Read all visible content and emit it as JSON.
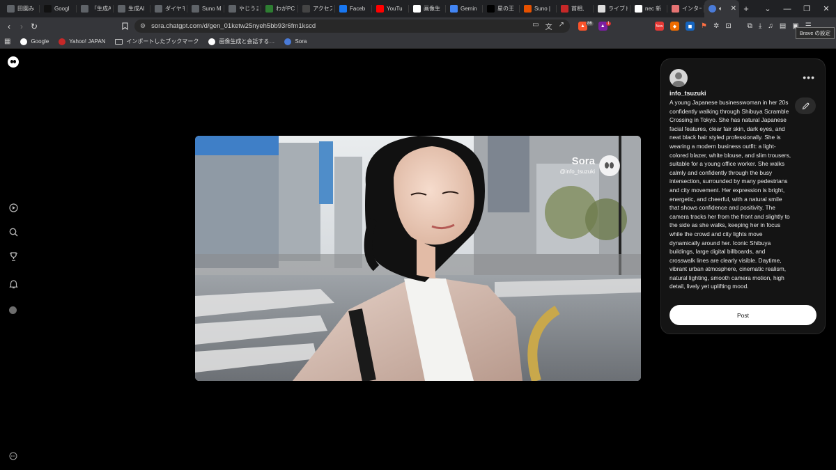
{
  "browser": {
    "tabs": [
      {
        "label": "田園み",
        "icon": "globe-icon",
        "color": "#5f6368"
      },
      {
        "label": "Googl",
        "icon": "tiktok-icon",
        "color": "#111111"
      },
      {
        "label": "「生成A",
        "icon": "globe-icon",
        "color": "#5f6368"
      },
      {
        "label": "生成AI",
        "icon": "gear-icon",
        "color": "#5f6368"
      },
      {
        "label": "ダイヤモ",
        "icon": "globe-icon",
        "color": "#5f6368"
      },
      {
        "label": "Suno M",
        "icon": "globe-icon",
        "color": "#5f6368"
      },
      {
        "label": "やじうま",
        "icon": "globe-icon",
        "color": "#5f6368"
      },
      {
        "label": "わがPC",
        "icon": "green-icon",
        "color": "#2e7d32"
      },
      {
        "label": "アクセス",
        "icon": "square-icon",
        "color": "#444444"
      },
      {
        "label": "Faceb",
        "icon": "facebook-icon",
        "color": "#1877f2"
      },
      {
        "label": "YouTu",
        "icon": "youtube-icon",
        "color": "#ff0000"
      },
      {
        "label": "画像生",
        "icon": "n-icon",
        "color": "#ffffff"
      },
      {
        "label": "Gemin",
        "icon": "gemini-icon",
        "color": "#4285f4"
      },
      {
        "label": "星の王",
        "icon": "x-icon",
        "color": "#000000"
      },
      {
        "label": "Suno |",
        "icon": "suno-icon",
        "color": "#e65100"
      },
      {
        "label": "首相,",
        "icon": "yahoo-icon",
        "color": "#c62828"
      },
      {
        "label": "ライブド",
        "icon": "livedoor-icon",
        "color": "#dddddd"
      },
      {
        "label": "nec 新",
        "icon": "google-icon",
        "color": "#ffffff"
      },
      {
        "label": "インター",
        "icon": "red-square-icon",
        "color": "#e57373"
      }
    ],
    "active_tab": {
      "label": "",
      "icon": "sora-icon",
      "audio": "speaker-icon",
      "close": "✕"
    },
    "new_tab": "+",
    "window_controls": {
      "minimize": "—",
      "maximize": "❐",
      "close": "✕"
    },
    "url": "sora.chatgpt.com/d/gen_01ketw25nyeh5bb93r6fm1kscd",
    "brave_badge": "86",
    "rewards_badge": "1",
    "tooltip": "Brave の設定",
    "bookmarks": [
      {
        "label": "Google",
        "icon": "google-icon",
        "color": "#ffffff"
      },
      {
        "label": "Yahoo! JAPAN",
        "icon": "yahoo-icon",
        "color": "#c62828"
      },
      {
        "label": "インポートしたブックマーク",
        "icon": "folder-icon",
        "color": ""
      },
      {
        "label": "画像生成と会話する…",
        "icon": "n-icon",
        "color": "#ffffff"
      },
      {
        "label": "Sora",
        "icon": "sora-icon",
        "color": "#4a7bd8"
      }
    ]
  },
  "video": {
    "watermark_title": "Sora",
    "watermark_handle": "@info_tsuzuki"
  },
  "panel": {
    "username": "info_tsuzuki",
    "more": "•••",
    "prompt": "A young Japanese businesswoman in her 20s confidently walking through Shibuya Scramble Crossing in Tokyo. She has natural Japanese facial features, clear fair skin, dark eyes, and neat black hair styled professionally. She is wearing a modern business outfit: a light-colored blazer, white blouse, and slim trousers, suitable for a young office worker. She walks calmly and confidently through the busy intersection, surrounded by many pedestrians and city movement. Her expression is bright, energetic, and cheerful, with a natural smile that shows confidence and positivity. The camera tracks her from the front and slightly to the side as she walks, keeping her in focus while the crowd and city lights move dynamically around her. Iconic Shibuya buildings, large digital billboards, and crosswalk lines are clearly visible. Daytime, vibrant urban atmosphere, cinematic realism, natural lighting, smooth camera motion, high detail, lively yet uplifting mood.",
    "post_button": "Post"
  }
}
